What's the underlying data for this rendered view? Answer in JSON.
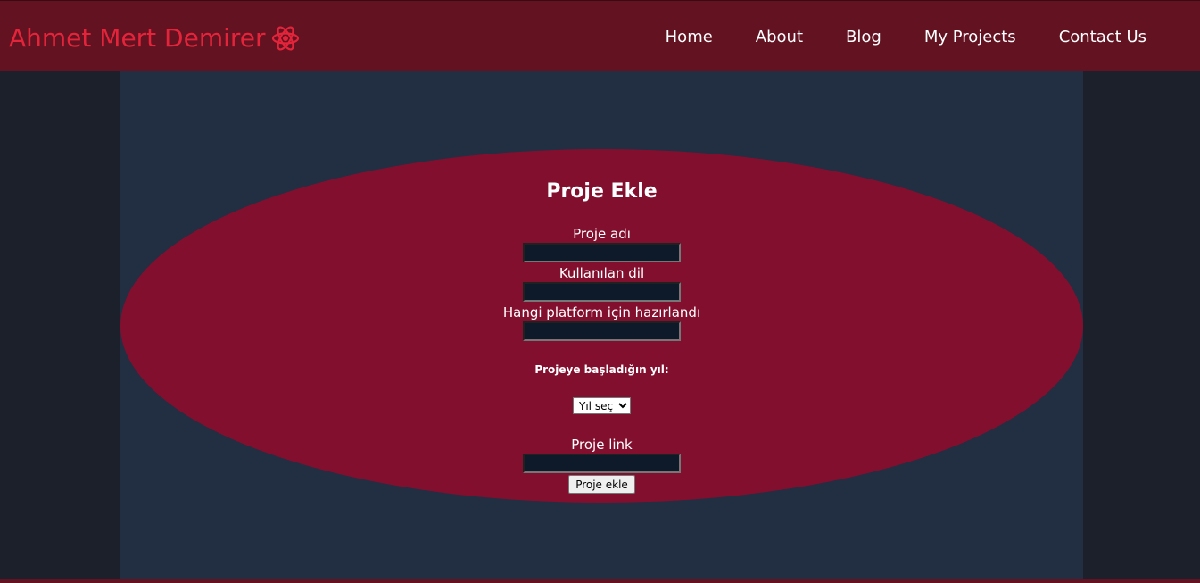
{
  "navbar": {
    "brand": "Ahmet Mert Demirer",
    "brand_icon": "atom-icon",
    "links": [
      "Home",
      "About",
      "Blog",
      "My Projects",
      "Contact Us"
    ]
  },
  "form": {
    "title": "Proje Ekle",
    "fields": {
      "name_label": "Proje adı",
      "name_value": "",
      "language_label": "Kullanılan dil",
      "language_value": "",
      "platform_label": "Hangi platform için hazırlandı",
      "platform_value": "",
      "year_label": "Projeye başladığın yıl:",
      "year_selected": "Yıl seç",
      "link_label": "Proje link",
      "link_value": ""
    },
    "submit_label": "Proje ekle"
  },
  "colors": {
    "navbar_bg": "#621220",
    "brand_text": "#e3243a",
    "page_bg": "#1b202b",
    "main_bg": "#222e42",
    "ellipse_bg": "#830f2e",
    "input_bg": "#0e1a2a"
  }
}
